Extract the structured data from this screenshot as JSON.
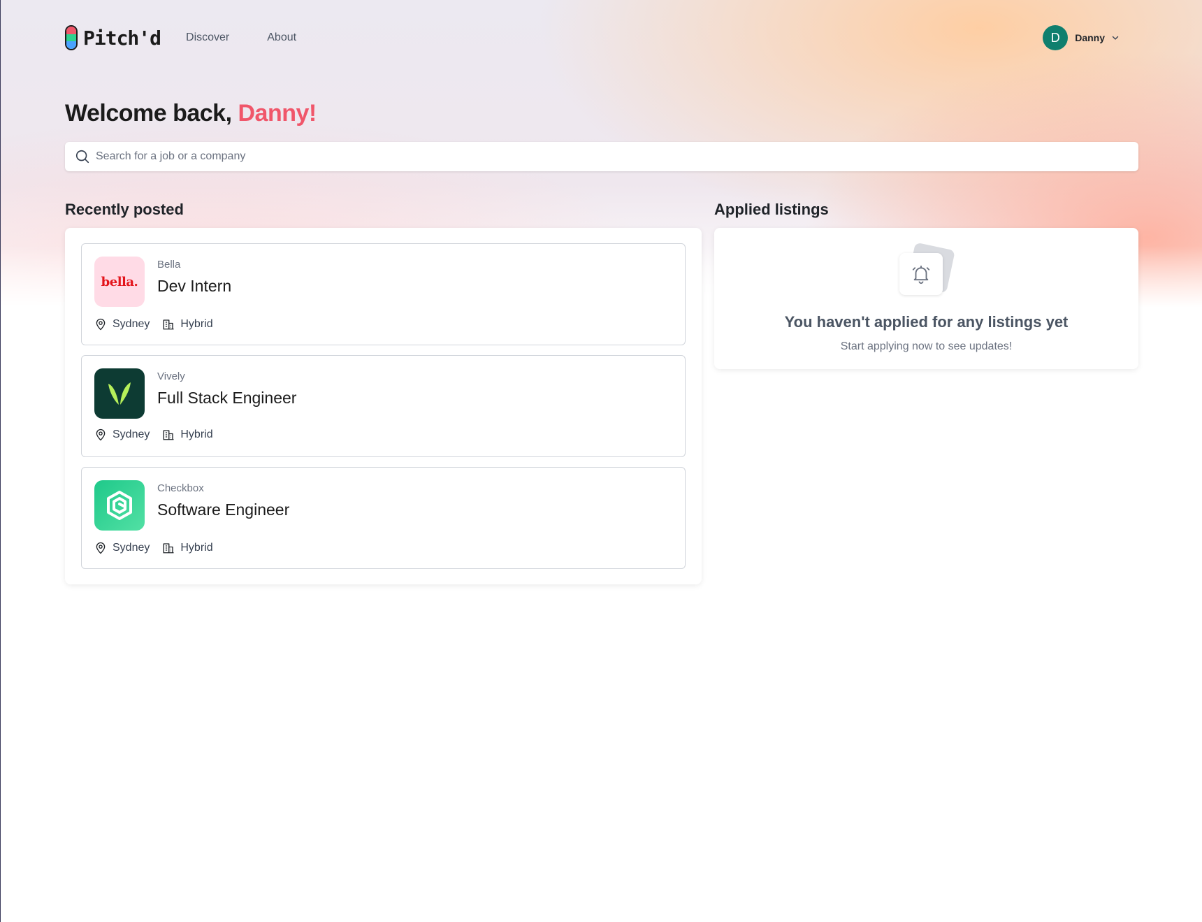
{
  "header": {
    "logo_text": "Pitch'd",
    "nav": [
      {
        "label": "Discover"
      },
      {
        "label": "About"
      }
    ],
    "user": {
      "initial": "D",
      "name": "Danny"
    }
  },
  "welcome": {
    "prefix": "Welcome back,",
    "name": "Danny!"
  },
  "search": {
    "placeholder": "Search for a job or a company"
  },
  "recent": {
    "title": "Recently posted",
    "jobs": [
      {
        "company": "Bella",
        "title": "Dev Intern",
        "location": "Sydney",
        "work_type": "Hybrid",
        "logo_text": "bella."
      },
      {
        "company": "Vively",
        "title": "Full Stack Engineer",
        "location": "Sydney",
        "work_type": "Hybrid"
      },
      {
        "company": "Checkbox",
        "title": "Software Engineer",
        "location": "Sydney",
        "work_type": "Hybrid"
      }
    ]
  },
  "applied": {
    "title": "Applied listings",
    "empty_title": "You haven't applied for any listings yet",
    "empty_subtitle": "Start applying now to see updates!"
  },
  "colors": {
    "accent": "#f0566a",
    "avatar": "#0f7f6e",
    "bella_bg": "#ffdbe6",
    "bella_text": "#e3141b",
    "vively_bg": "#0d3b33",
    "vively_leaf": "#b6f05a",
    "checkbox_bg": "#2fd28f"
  },
  "icons": [
    "logo-pill-icon",
    "chevron-down-icon",
    "search-icon",
    "map-pin-icon",
    "building-icon",
    "bell-icon"
  ]
}
